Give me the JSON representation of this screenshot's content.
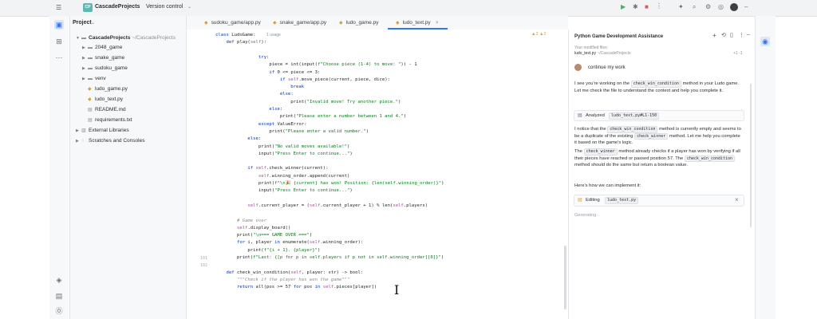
{
  "titlebar": {
    "project_badge": "CP",
    "project_name": "CascadeProjects",
    "vcs": "Version control"
  },
  "project_panel": {
    "title": "Project",
    "root": "CascadeProjects",
    "root_path": "~/CascadeProjects",
    "items": [
      {
        "label": "2048_game",
        "type": "folder"
      },
      {
        "label": "snake_game",
        "type": "folder"
      },
      {
        "label": "sudoku_game",
        "type": "folder"
      },
      {
        "label": "venv",
        "type": "folder"
      },
      {
        "label": "ludo_game.py",
        "type": "file"
      },
      {
        "label": "ludo_text.py",
        "type": "file"
      },
      {
        "label": "README.md",
        "type": "file"
      },
      {
        "label": "requirements.txt",
        "type": "file"
      }
    ],
    "external": "External Libraries",
    "scratches": "Scratches and Consoles"
  },
  "tabs": [
    {
      "label": "sudoku_game/app.py"
    },
    {
      "label": "snake_game/app.py"
    },
    {
      "label": "ludo_game.py"
    },
    {
      "label": "ludo_text.py"
    }
  ],
  "editor": {
    "usage_hint": "1 usage",
    "inspections": "▲2 ▲2",
    "line_numbers": [
      "",
      "",
      "",
      "",
      "",
      "",
      "",
      "",
      "",
      "",
      "",
      "",
      "",
      "",
      "",
      "",
      "",
      "",
      "",
      "",
      "",
      "",
      "",
      "",
      "",
      "",
      "",
      "",
      "",
      "",
      "101",
      "102",
      "",
      ""
    ],
    "lines": [
      "class LudoGame:",
      "    def play(self):",
      "                ",
      "                try:",
      "                    piece = int(input(f\"Choose piece (1-4) to move: \")) - 1",
      "                    if 0 <= piece <= 3:",
      "                        if self.move_piece(current, piece, dice):",
      "                            break",
      "                        else:",
      "                            print(\"Invalid move! Try another piece.\")",
      "                    else:",
      "                        print(\"Please enter a number between 1 and 4.\")",
      "                except ValueError:",
      "                    print(\"Please enter a valid number.\")",
      "            else:",
      "                print(\"No valid moves available!\")",
      "                input(\"Press Enter to continue...\")",
      "",
      "            if self.check_winner(current):",
      "                self.winning_order.append(current)",
      "                print(f\"\\n🎉 {current} has won! Position: {len(self.winning_order)}\")",
      "                input(\"Press Enter to continue...\")",
      "",
      "            self.current_player = (self.current_player + 1) % len(self.players)",
      "",
      "        # Game over",
      "        self.display_board()",
      "        print(\"\\n=== GAME OVER ===\")",
      "        for i, player in enumerate(self.winning_order):",
      "            print(f\"{i + 1}. {player}\")",
      "        print(f\"Last: {[p for p in self.players if p not in self.winning_order][0]}\")",
      "",
      "    def check_win_condition(self, player: str) -> bool:",
      "        \"\"\"Check if the player has won the game\"\"\"",
      "        return all(pos >= 57 for pos in self.pieces[player])"
    ]
  },
  "assistant": {
    "title": "Python Game Development Assistance",
    "modified_label": "Your modified files:",
    "modified_file": "ludo_text.py",
    "modified_path": "~/CascadeProjects",
    "modified_diff": "+1 -1",
    "user_message": "continue my work",
    "para1_a": "I see you're working on the",
    "para1_chip": "check_win_condition",
    "para1_b": "method in your Ludo game. Let me check the file to understand the context and help you complete it.",
    "analyzed_label": "Analyzed",
    "analyzed_chip": "ludo_text.py#L1-150",
    "para2_a": "I notice that the",
    "para2_chip1": "check_win_condition",
    "para2_b": "method is currently empty and seems to be a duplicate of the existing",
    "para2_chip2": "check_winner",
    "para2_c": "method. Let me help you complete it based on the game's logic.",
    "para3_a": "The",
    "para3_chip1": "check_winner",
    "para3_b": "method already checks if a player has won by verifying if all their pieces have reached or passed position 57. The",
    "para3_chip2": "check_win_condition",
    "para3_c": "method should do the same but return a boolean value.",
    "para4": "Here's how we can implement it:",
    "editing_label": "Editing",
    "editing_chip": "ludo_text.py",
    "status": "Generating."
  }
}
